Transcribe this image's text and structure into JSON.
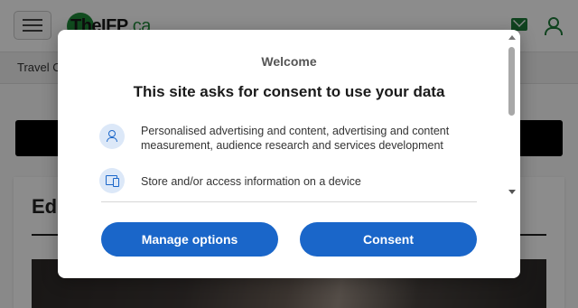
{
  "site": {
    "logo_main": "TheIFP",
    "logo_tld": ".ca",
    "breadcrumb": "Travel C",
    "article_title": "Edi"
  },
  "icons": {
    "menu": "hamburger-icon",
    "mail": "envelope-icon",
    "account": "user-icon",
    "purpose_1": "person-icon",
    "purpose_2": "devices-icon"
  },
  "consent": {
    "welcome": "Welcome",
    "headline": "This site asks for consent to use your data",
    "purposes": [
      {
        "text": "Personalised advertising and content, advertising and content measurement, audience research and services development"
      },
      {
        "text": "Store and/or access information on a device"
      }
    ],
    "manage_label": "Manage options",
    "consent_label": "Consent"
  },
  "colors": {
    "brand_green": "#1e7a3a",
    "button_blue": "#1a66c9",
    "icon_bg": "#dce8f8"
  }
}
